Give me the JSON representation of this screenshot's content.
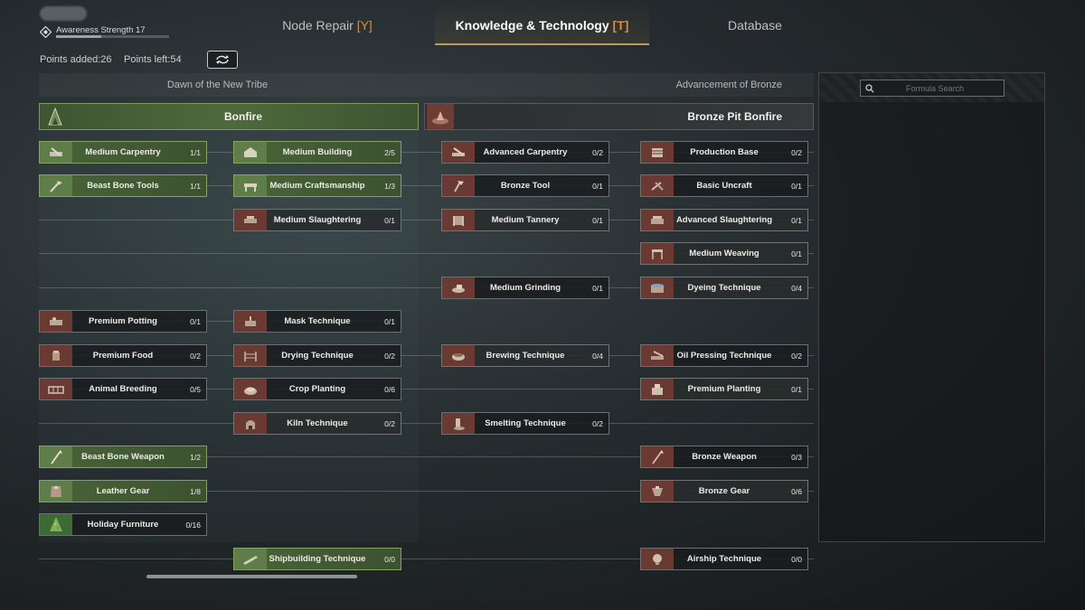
{
  "player": {
    "awareness_label": "Awareness Strength 17",
    "awareness_progress": 0.4
  },
  "tabs": [
    {
      "label": "Node Repair ",
      "hotkey": "[Y]"
    },
    {
      "label": "Knowledge & Technology ",
      "hotkey": "[T]"
    },
    {
      "label": "Database",
      "hotkey": ""
    }
  ],
  "points": {
    "added": "Points added:26",
    "left": "Points left:54"
  },
  "eras": {
    "left": "Dawn of the New Tribe",
    "right": "Advancement of Bronze"
  },
  "bonfires": {
    "left": "Bonfire",
    "right": "Bronze Pit Bonfire"
  },
  "search": {
    "placeholder": "Formula Search"
  },
  "nodes": {
    "medium_carpentry": {
      "label": "Medium Carpentry",
      "count": "1/1"
    },
    "beast_bone_tools": {
      "label": "Beast Bone Tools",
      "count": "1/1"
    },
    "premium_potting": {
      "label": "Premium Potting",
      "count": "0/1"
    },
    "premium_food": {
      "label": "Premium Food",
      "count": "0/2"
    },
    "animal_breeding": {
      "label": "Animal Breeding",
      "count": "0/5"
    },
    "beast_bone_weapon": {
      "label": "Beast Bone Weapon",
      "count": "1/2"
    },
    "leather_gear": {
      "label": "Leather Gear",
      "count": "1/8"
    },
    "holiday_furniture": {
      "label": "Holiday Furniture",
      "count": "0/16"
    },
    "medium_building": {
      "label": "Medium Building",
      "count": "2/5"
    },
    "medium_craftsmanship": {
      "label": "Medium Craftsmanship",
      "count": "1/3"
    },
    "medium_slaughtering": {
      "label": "Medium Slaughtering",
      "count": "0/1"
    },
    "mask_technique": {
      "label": "Mask Technique",
      "count": "0/1"
    },
    "drying_technique": {
      "label": "Drying Technique",
      "count": "0/2"
    },
    "crop_planting": {
      "label": "Crop Planting",
      "count": "0/6"
    },
    "kiln_technique": {
      "label": "Kiln Technique",
      "count": "0/2"
    },
    "shipbuilding_technique": {
      "label": "Shipbuilding Technique",
      "count": "0/0"
    },
    "advanced_carpentry": {
      "label": "Advanced Carpentry",
      "count": "0/2"
    },
    "bronze_tool": {
      "label": "Bronze Tool",
      "count": "0/1"
    },
    "medium_tannery": {
      "label": "Medium Tannery",
      "count": "0/1"
    },
    "medium_grinding": {
      "label": "Medium Grinding",
      "count": "0/1"
    },
    "brewing_technique": {
      "label": "Brewing Technique",
      "count": "0/4"
    },
    "smelting_technique": {
      "label": "Smelting Technique",
      "count": "0/2"
    },
    "production_base": {
      "label": "Production Base",
      "count": "0/2"
    },
    "basic_uncraft": {
      "label": "Basic Uncraft",
      "count": "0/1"
    },
    "advanced_slaughtering": {
      "label": "Advanced Slaughtering",
      "count": "0/1"
    },
    "medium_weaving": {
      "label": "Medium Weaving",
      "count": "0/1"
    },
    "dyeing_technique": {
      "label": "Dyeing Technique",
      "count": "0/4"
    },
    "oil_pressing_technique": {
      "label": "Oil Pressing Technique",
      "count": "0/2"
    },
    "premium_planting": {
      "label": "Premium Planting",
      "count": "0/1"
    },
    "bronze_weapon": {
      "label": "Bronze Weapon",
      "count": "0/3"
    },
    "bronze_gear": {
      "label": "Bronze Gear",
      "count": "0/6"
    },
    "airship_technique": {
      "label": "Airship Technique",
      "count": "0/0"
    }
  },
  "colors": {
    "unlocked": "#4a6438",
    "locked_icon": "#6a3a32",
    "accent": "#d98d3a"
  }
}
